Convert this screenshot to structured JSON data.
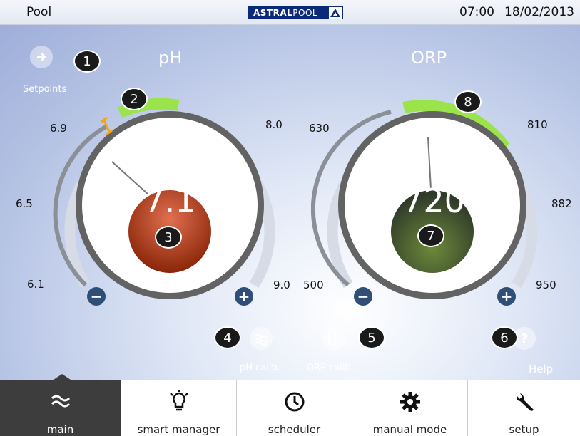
{
  "header": {
    "location": "Pool",
    "brand_left": "ASTRAL",
    "brand_right": "POOL",
    "time": "07:00",
    "date": "18/02/2013"
  },
  "setpoints": {
    "label": "Setpoints",
    "icon": "arrow-circle-icon"
  },
  "ph": {
    "title": "pH",
    "value": "7.1",
    "scale": [
      "6.1",
      "6.5",
      "6.9",
      "8.0",
      "9.0"
    ],
    "color": "#b03515"
  },
  "orp": {
    "title": "ORP",
    "value": "720",
    "scale": [
      "500",
      "630",
      "810",
      "882",
      "950"
    ],
    "color": "#3d4a2c"
  },
  "actions": {
    "ph_calib": "pH calib.",
    "orp_calib": "ORP calib.",
    "help": "Help"
  },
  "badges": [
    "1",
    "2",
    "3",
    "4",
    "5",
    "6",
    "7",
    "8"
  ],
  "tabs": [
    {
      "label": "main",
      "icon": "waves-icon"
    },
    {
      "label": "smart manager",
      "icon": "lightbulb-icon"
    },
    {
      "label": "scheduler",
      "icon": "clock-icon"
    },
    {
      "label": "manual mode",
      "icon": "gear-icon"
    },
    {
      "label": "setup",
      "icon": "wrench-icon"
    }
  ],
  "colors": {
    "accent": "#9be34a",
    "ring": "#636363",
    "minus_plus": "#2f4f76"
  }
}
